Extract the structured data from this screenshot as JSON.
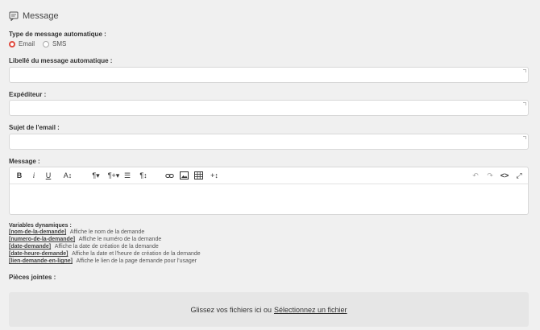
{
  "header": {
    "title": "Message",
    "icon": "message-icon"
  },
  "type": {
    "label": "Type de message automatique :",
    "options": [
      {
        "label": "Email",
        "selected": true
      },
      {
        "label": "SMS",
        "selected": false
      }
    ]
  },
  "fields": {
    "libelle": {
      "label": "Libellé du message automatique :",
      "value": ""
    },
    "expediteur": {
      "label": "Expéditeur :",
      "value": ""
    },
    "sujet": {
      "label": "Sujet de l'email :",
      "value": ""
    }
  },
  "message": {
    "label": "Message :",
    "toolbar": {
      "bold": "B",
      "italic": "i",
      "underline": "U",
      "font_size": "A↕",
      "paragraph": "¶▾",
      "paragraph_style": "¶+▾",
      "list": "☰",
      "direction": "¶↕",
      "link": "🔗",
      "image": "▣",
      "table": "▦",
      "insert": "+↕",
      "undo": "↶",
      "redo": "↷",
      "code": "<>",
      "fullscreen": "⤢"
    }
  },
  "variables": {
    "title": "Variables dynamiques :",
    "items": [
      {
        "code": "[nom-de-la-demande]",
        "desc": "Affiche le nom de la demande"
      },
      {
        "code": "[numero-de-la-demande]",
        "desc": "Affiche le numéro de la demande"
      },
      {
        "code": "[date-demande]",
        "desc": "Affiche la date de création de la demande"
      },
      {
        "code": "[date-heure-demande]",
        "desc": "Affiche la date et l'heure de création de la demande"
      },
      {
        "code": "[lien-demande-en-ligne]",
        "desc": "Affiche le lien de la page demande pour l'usager"
      }
    ]
  },
  "attachments": {
    "label": "Pièces jointes :",
    "drop_text": "Glissez vos fichiers ici ou",
    "select_link": "Sélectionnez un fichier"
  },
  "colors": {
    "accent": "#e04b3f",
    "background": "#f0f0f0"
  }
}
